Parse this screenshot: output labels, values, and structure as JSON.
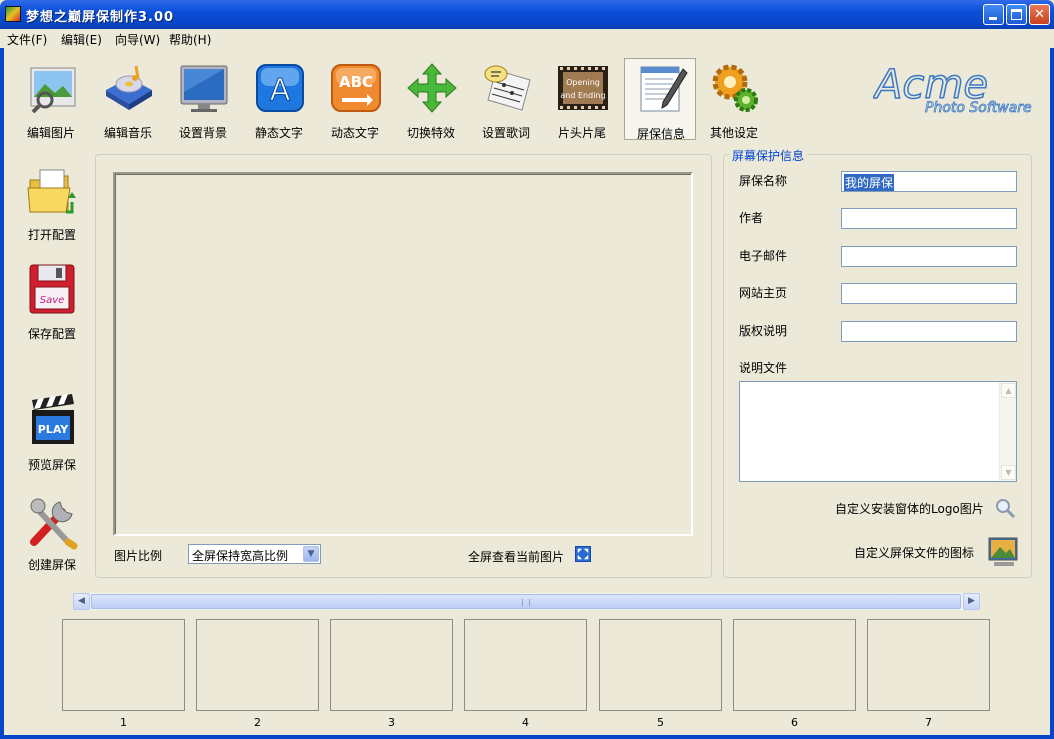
{
  "window": {
    "title": "梦想之巅屏保制作3.00"
  },
  "menu": [
    "文件(F)",
    "编辑(E)",
    "向导(W)",
    "帮助(H)"
  ],
  "toolbar": [
    {
      "label": "编辑图片",
      "icon": "edit-picture-icon"
    },
    {
      "label": "编辑音乐",
      "icon": "edit-music-icon"
    },
    {
      "label": "设置背景",
      "icon": "monitor-background-icon"
    },
    {
      "label": "静态文字",
      "icon": "static-text-icon"
    },
    {
      "label": "动态文字",
      "icon": "animated-text-icon"
    },
    {
      "label": "切换特效",
      "icon": "transition-effect-icon"
    },
    {
      "label": "设置歌词",
      "icon": "lyrics-icon"
    },
    {
      "label": "片头片尾",
      "icon": "opening-ending-icon"
    },
    {
      "label": "屏保信息",
      "icon": "screensaver-info-icon"
    },
    {
      "label": "其他设定",
      "icon": "gears-settings-icon"
    }
  ],
  "opening_ending_text": [
    "Opening",
    "and Ending"
  ],
  "logo": {
    "brand": "Acme",
    "sub": "Photo Software"
  },
  "sidebar": [
    {
      "label": "打开配置",
      "icon": "open-folder-icon"
    },
    {
      "label": "保存配置",
      "icon": "save-disk-icon"
    },
    {
      "label": "预览屏保",
      "icon": "play-clapper-icon"
    },
    {
      "label": "创建屏保",
      "icon": "tools-icon"
    }
  ],
  "save_icon_text": "Save",
  "play_icon_text": "PLAY",
  "preview": {
    "ratio_label": "图片比例",
    "ratio_value": "全屏保持宽高比例",
    "fullscreen_label": "全屏查看当前图片"
  },
  "info": {
    "legend": "屏幕保护信息",
    "fields": [
      {
        "label": "屏保名称",
        "value": "我的屏保"
      },
      {
        "label": "作者",
        "value": ""
      },
      {
        "label": "电子邮件",
        "value": ""
      },
      {
        "label": "网站主页",
        "value": ""
      },
      {
        "label": "版权说明",
        "value": ""
      }
    ],
    "desc_label": "说明文件",
    "logo_label": "自定义安装窗体的Logo图片",
    "icon_label": "自定义屏保文件的图标"
  },
  "thumbnails": [
    "1",
    "2",
    "3",
    "4",
    "5",
    "6",
    "7"
  ],
  "colors": {
    "accent": "#0846c9",
    "legend": "#0046d5"
  }
}
